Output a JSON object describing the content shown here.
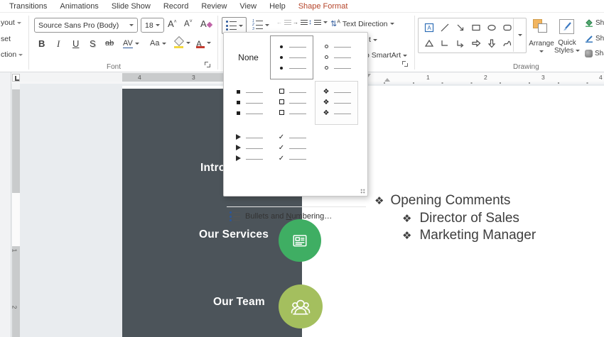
{
  "tabs": [
    {
      "label": "Transitions"
    },
    {
      "label": "Animations"
    },
    {
      "label": "Slide Show"
    },
    {
      "label": "Record"
    },
    {
      "label": "Review"
    },
    {
      "label": "View"
    },
    {
      "label": "Help"
    },
    {
      "label": "Shape Format"
    }
  ],
  "ribbon": {
    "left_rail": {
      "item1": "yout",
      "item2": "set",
      "item3": "ction"
    },
    "font": {
      "group_label": "Font",
      "family": "Source Sans Pro (Body)",
      "size": "18",
      "grow": "A",
      "shrink": "A",
      "clear": "A",
      "bold": "B",
      "italic": "I",
      "underline": "U",
      "shadow": "S",
      "strikethrough": "ab",
      "char_spacing": "AV",
      "change_case": "Aa",
      "font_color": "A"
    },
    "paragraph": {
      "text_direction_label": "Text Direction",
      "align_text_cut": "t",
      "smartart_cut": "o SmartArt"
    },
    "drawing": {
      "group_label": "Drawing",
      "arrange_label": "Arrange",
      "quick_label_1": "Quick",
      "quick_label_2": "Styles",
      "shape_fill_cut": "Sha",
      "shape_outline_cut": "Sha",
      "shape_effects_cut": "Sha"
    }
  },
  "menu": {
    "none_label": "None",
    "footer_prefix": "Bullets and ",
    "footer_accel": "N",
    "footer_suffix": "umbering…"
  },
  "rulers": {
    "h_left_1": "4",
    "h_left_2": "3",
    "h_right_1": "1",
    "h_right_2": "2",
    "h_right_3": "3",
    "h_right_4": "4",
    "v_1": "1",
    "v_2": "2"
  },
  "slide": {
    "nav_intro": "Intro",
    "nav_services": "Our Services",
    "nav_team": "Our Team",
    "bullets": [
      {
        "level": 1,
        "text": "Opening Comments"
      },
      {
        "level": 2,
        "text": "Director of Sales"
      },
      {
        "level": 2,
        "text": "Marketing Manager"
      }
    ]
  },
  "glyphs": {
    "diamond": "❖",
    "check": "✓"
  },
  "colors": {
    "tab_accent": "#b5442a",
    "sidebar_panel": "#4c545a",
    "services_green": "#3fae63",
    "team_olive": "#a4bf5e"
  }
}
